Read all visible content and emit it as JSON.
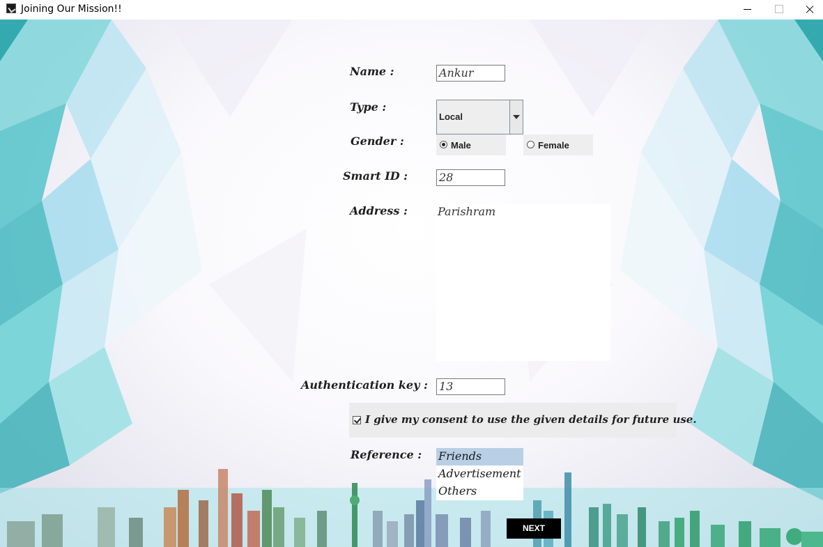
{
  "window": {
    "title": "Joining Our Mission!!",
    "icon": "app-icon",
    "controls": [
      "minimize-icon",
      "maximize-icon",
      "close-icon"
    ]
  },
  "form": {
    "name": {
      "label": "Name :",
      "value": "Ankur"
    },
    "type": {
      "label": "Type :",
      "selected": "Local"
    },
    "gender": {
      "label": "Gender :",
      "options": [
        {
          "label": "Male",
          "selected": true
        },
        {
          "label": "Female",
          "selected": false
        }
      ]
    },
    "smart_id": {
      "label": "Smart ID :",
      "value": "28"
    },
    "address": {
      "label": "Address :",
      "value": "Parishram"
    },
    "auth_key": {
      "label": "Authentication key :",
      "value": "13"
    },
    "consent": {
      "label": "I give my consent to use the given details for future use.",
      "checked": true
    },
    "reference": {
      "label": "Reference :",
      "options": [
        "Friends",
        "Advertisement",
        "Others"
      ],
      "selected": "Friends"
    },
    "next_label": "NEXT"
  },
  "colors": {
    "background_crystal_teal": "#6fd3d6",
    "background_crystal_blue": "#9fd2ee",
    "list_selection": "#b8cfe5",
    "button_bg": "#000000",
    "button_text": "#ffffff"
  }
}
